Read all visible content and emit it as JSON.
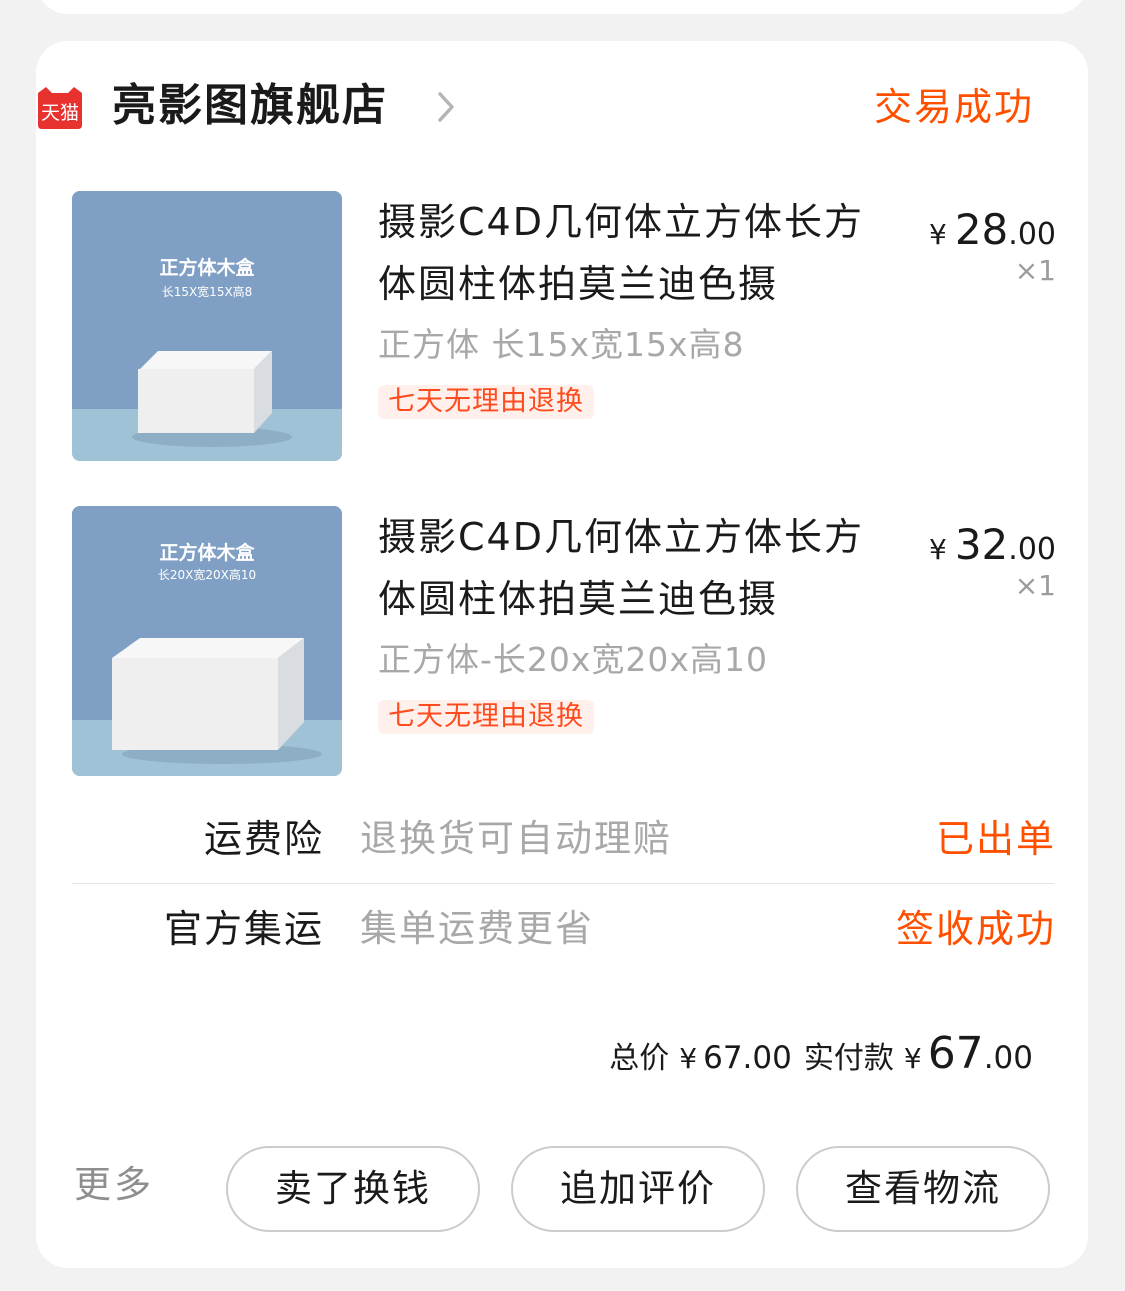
{
  "shop": {
    "logo_text": "天猫",
    "name": "亮影图旗舰店",
    "order_status": "交易成功"
  },
  "products": [
    {
      "thumb_title": "正方体木盒",
      "thumb_sub": "长15X宽15X高8",
      "title": "摄影C4D几何体立方体长方体圆柱体拍莫兰迪色摄",
      "spec": "正方体 长15x宽15x高8",
      "tag": "七天无理由退换",
      "price_symbol": "¥",
      "price_int": "28",
      "price_dec": ".00",
      "quantity": "×1"
    },
    {
      "thumb_title": "正方体木盒",
      "thumb_sub": "长20X宽20X高10",
      "title": "摄影C4D几何体立方体长方体圆柱体拍莫兰迪色摄",
      "spec": "正方体-长20x宽20x高10",
      "tag": "七天无理由退换",
      "price_symbol": "¥",
      "price_int": "32",
      "price_dec": ".00",
      "quantity": "×1"
    }
  ],
  "services": [
    {
      "label": "运费险",
      "description": "退换货可自动理赔",
      "status": "已出单"
    },
    {
      "label": "官方集运",
      "description": "集单运费更省",
      "status": "签收成功"
    }
  ],
  "totals": {
    "total_label": "总价",
    "total_symbol": "¥",
    "total_value": "67.00",
    "paid_label": "实付款",
    "paid_symbol": "¥",
    "paid_int": "67",
    "paid_dec": ".00"
  },
  "actions": {
    "more": "更多",
    "buttons": [
      "卖了换钱",
      "追加评价",
      "查看物流"
    ]
  },
  "colors": {
    "accent": "#ff5000",
    "tag_bg": "#fff0ec",
    "tmall_red": "#e8322f",
    "thumb_bg": "#7f9fc4",
    "thumb_floor": "#9fc2d6"
  },
  "icons": {
    "shop_logo": "tmall-logo-icon",
    "shop_link": "chevron-right-icon"
  }
}
